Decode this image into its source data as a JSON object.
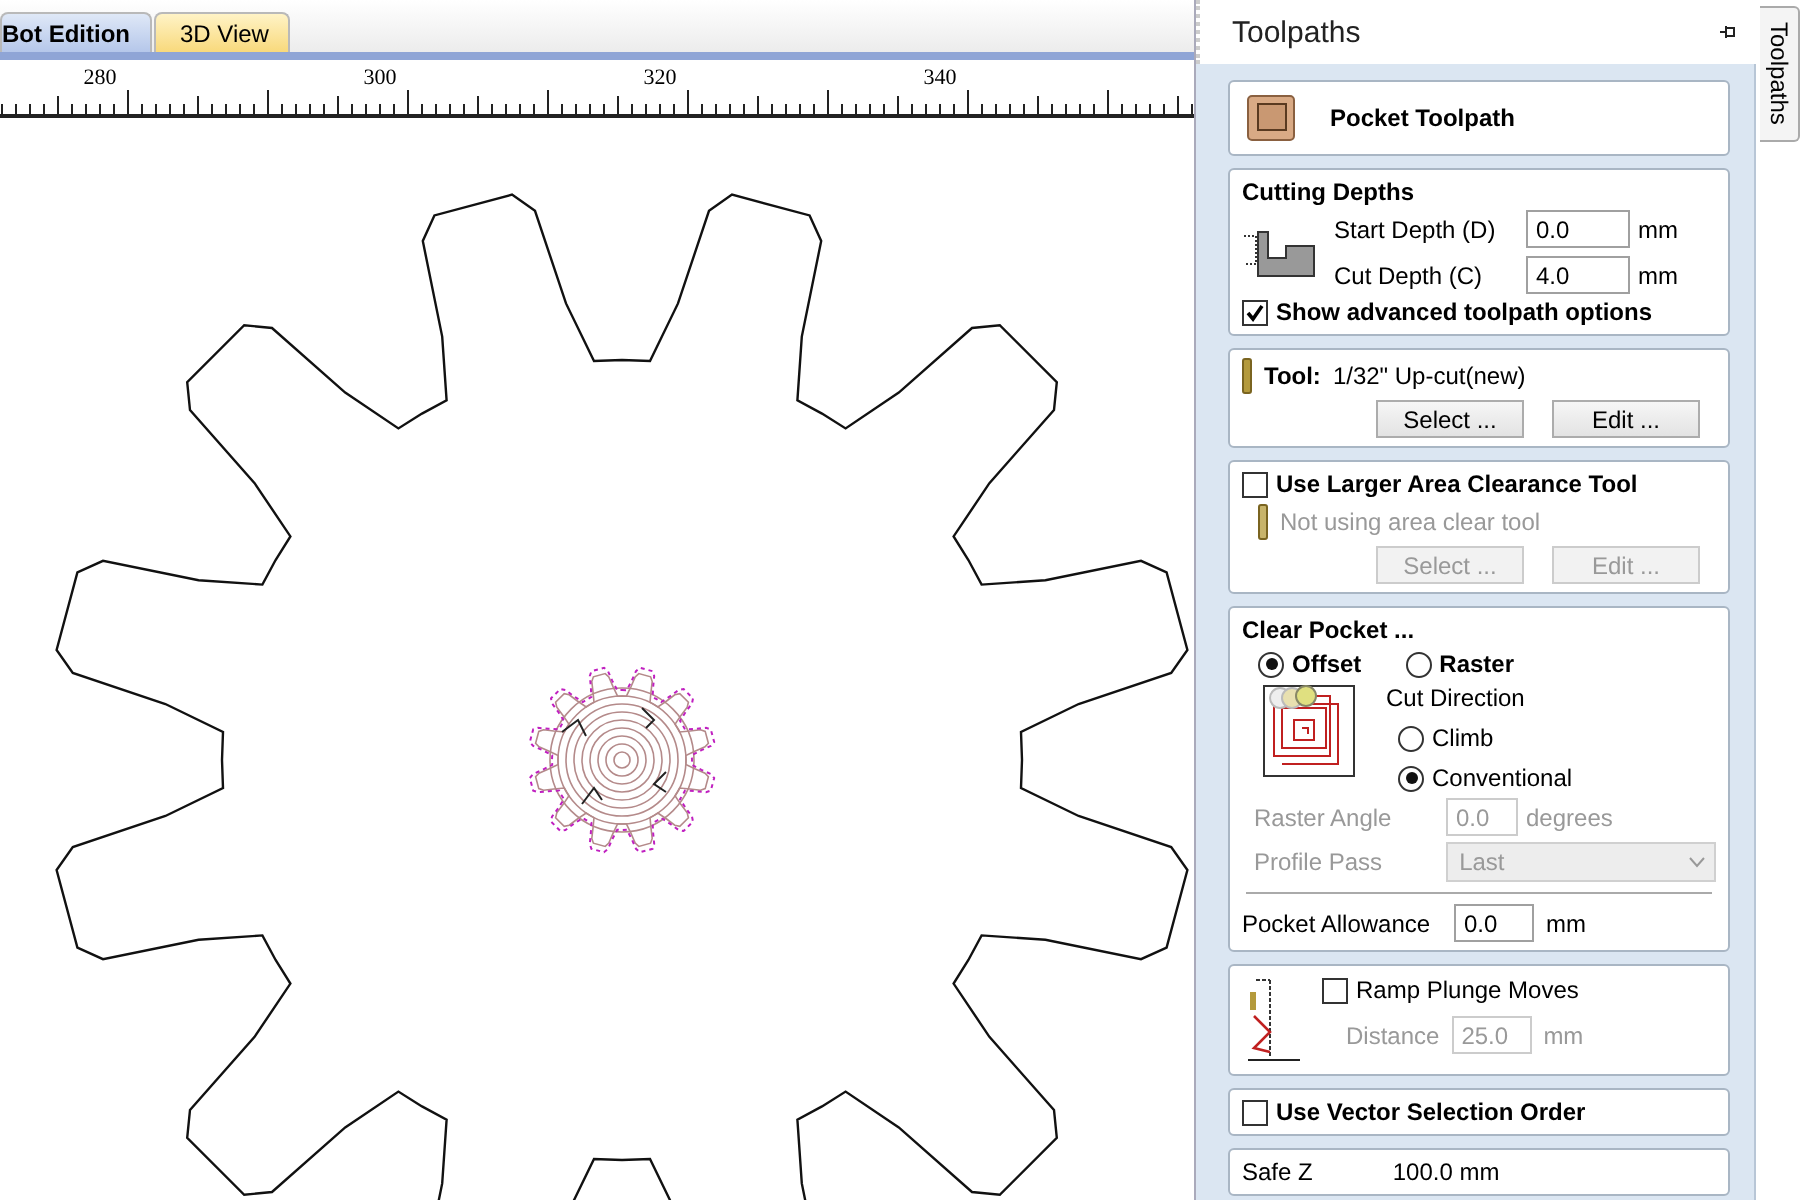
{
  "tabs": [
    {
      "label": "Bot Edition",
      "selected": true
    },
    {
      "label": "3D View",
      "selected": false
    }
  ],
  "ruler": {
    "labels": [
      "280",
      "300",
      "320",
      "340"
    ]
  },
  "panel": {
    "title": "Toolpaths",
    "side_tab": "Toolpaths"
  },
  "header": {
    "title": "Pocket Toolpath"
  },
  "cutting_depths": {
    "title": "Cutting Depths",
    "fields": [
      {
        "label": "Start Depth (D)",
        "value": "0.0",
        "unit": "mm"
      },
      {
        "label": "Cut Depth (C)",
        "value": "4.0",
        "unit": "mm"
      }
    ],
    "show_advanced": {
      "label": "Show advanced toolpath options",
      "checked": true
    }
  },
  "tool": {
    "label": "Tool:",
    "name": "1/32\" Up-cut(new)",
    "buttons": [
      "Select ...",
      "Edit ..."
    ]
  },
  "area_clearance": {
    "label": "Use Larger Area Clearance Tool",
    "checked": false,
    "note": "Not using area clear tool",
    "buttons": [
      "Select ...",
      "Edit ..."
    ]
  },
  "clear_pocket": {
    "title": "Clear Pocket ...",
    "strategies": [
      {
        "label": "Offset",
        "selected": true
      },
      {
        "label": "Raster",
        "selected": false
      }
    ],
    "cut_direction": {
      "label": "Cut Direction",
      "options": [
        {
          "label": "Climb",
          "selected": false
        },
        {
          "label": "Conventional",
          "selected": true
        }
      ]
    },
    "raster_angle": {
      "label": "Raster Angle",
      "value": "0.0",
      "unit": "degrees",
      "disabled": true
    },
    "profile_pass": {
      "label": "Profile Pass",
      "value": "Last",
      "disabled": true
    },
    "allowance": {
      "label": "Pocket Allowance",
      "value": "0.0",
      "unit": "mm"
    }
  },
  "ramp": {
    "label": "Ramp Plunge Moves",
    "checked": false,
    "distance": {
      "label": "Distance",
      "value": "25.0",
      "unit": "mm",
      "disabled": true
    }
  },
  "vector_order": {
    "label": "Use Vector Selection Order",
    "checked": false
  },
  "safe_z": {
    "label": "Safe Z",
    "value": "100.0 mm"
  }
}
